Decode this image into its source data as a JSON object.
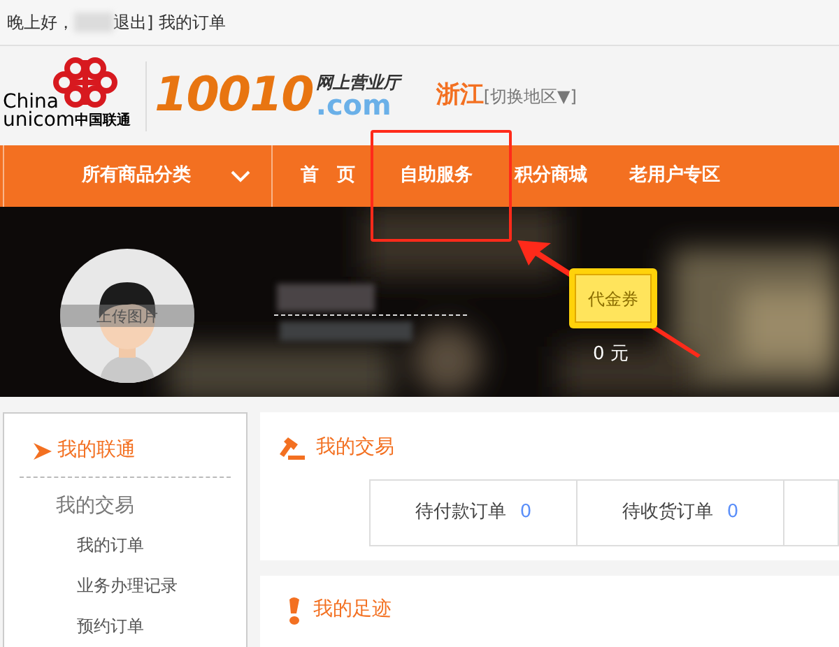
{
  "top_bar": {
    "greeting": "晚上好，",
    "logout": "退出]",
    "orders_link": "我的订单"
  },
  "header": {
    "logo_en_1": "China",
    "logo_en_2": "unicom",
    "logo_cn": "中国联通",
    "site_number": "10010",
    "site_title": "网上营业厅",
    "site_domain": ".com",
    "region": "浙江",
    "switch_region": "[切换地区▼]"
  },
  "nav": {
    "category": "所有商品分类",
    "items": [
      {
        "label": "首　页"
      },
      {
        "label": "自助服务"
      },
      {
        "label": "积分商城"
      },
      {
        "label": "老用户专区"
      }
    ]
  },
  "banner": {
    "upload_photo": "上传图片",
    "voucher": "代金券",
    "voucher_amount": "0 元"
  },
  "sidebar": {
    "title": "我的联通",
    "sections": [
      {
        "label": "我的交易",
        "children": [
          {
            "label": "我的订单"
          },
          {
            "label": "业务办理记录"
          },
          {
            "label": "预约订单"
          }
        ]
      }
    ]
  },
  "transactions": {
    "title": "我的交易",
    "orders": [
      {
        "label": "待付款订单",
        "count": "0"
      },
      {
        "label": "待收货订单",
        "count": "0"
      }
    ]
  },
  "footprints": {
    "title": "我的足迹"
  }
}
